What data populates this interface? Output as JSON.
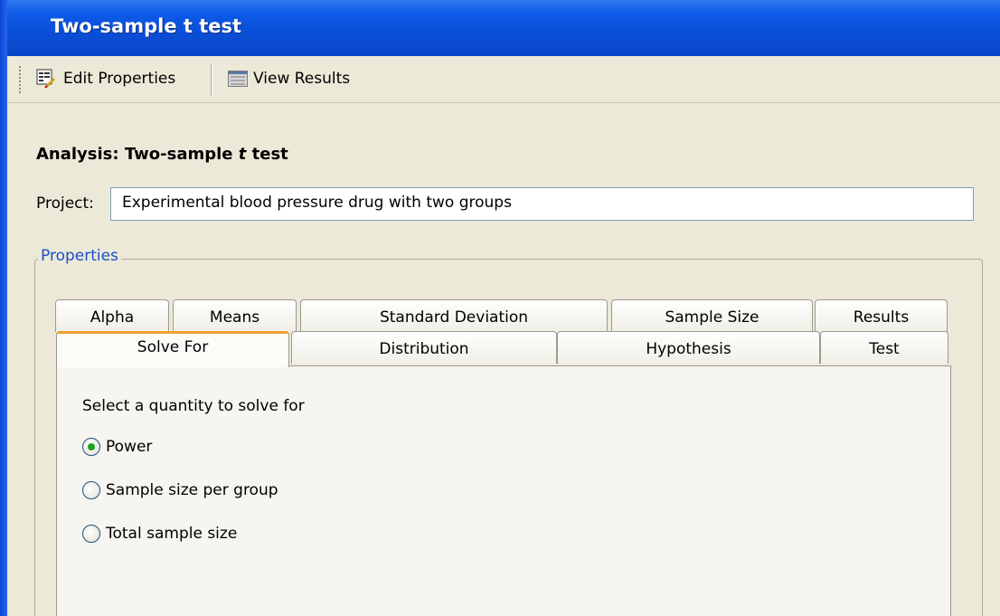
{
  "window": {
    "title": "Two-sample t test"
  },
  "toolbar": {
    "edit_label": "Edit Properties",
    "view_label": "View Results"
  },
  "analysis": {
    "prefix": "Analysis: Two-sample ",
    "t": "t",
    "suffix": " test"
  },
  "project": {
    "label": "Project:",
    "value": "Experimental blood pressure drug with two groups"
  },
  "properties": {
    "legend": "Properties"
  },
  "tabs_row1": [
    "Alpha",
    "Means",
    "Standard Deviation",
    "Sample Size",
    "Results"
  ],
  "tabs_row2": [
    "Solve For",
    "Distribution",
    "Hypothesis",
    "Test"
  ],
  "active_tab": "Solve For",
  "solve_for": {
    "prompt": "Select a quantity to solve for",
    "options": [
      "Power",
      "Sample size per group",
      "Total sample size"
    ],
    "selected": "Power"
  },
  "colors": {
    "titlebar": "#0a4ed6",
    "legend_text": "#1a4ec8",
    "active_tab_accent": "#f0a030",
    "radio_dot": "#21a121"
  }
}
